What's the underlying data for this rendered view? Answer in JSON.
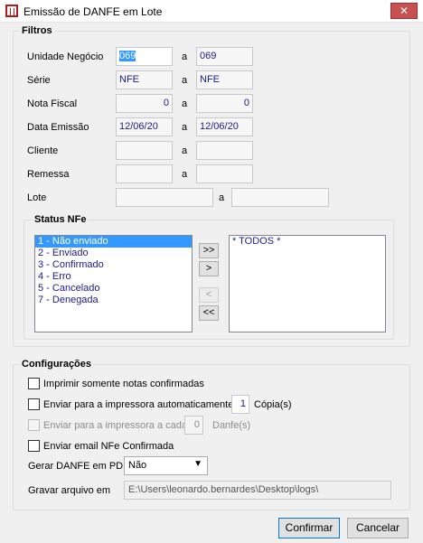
{
  "window": {
    "title": "Emissão de DANFE em Lote",
    "close_glyph": "✕"
  },
  "filtros": {
    "title": "Filtros",
    "range_sep": "a",
    "rows": [
      {
        "label": "Unidade Negócio",
        "from": "069",
        "to": "069"
      },
      {
        "label": "Série",
        "from": "NFE",
        "to": "NFE"
      },
      {
        "label": "Nota Fiscal",
        "from": "0",
        "to": "0"
      },
      {
        "label": "Data Emissão",
        "from": "12/06/20",
        "to": "12/06/20"
      },
      {
        "label": "Cliente",
        "from": "",
        "to": ""
      },
      {
        "label": "Remessa",
        "from": "",
        "to": ""
      },
      {
        "label": "Lote",
        "from": "",
        "to": ""
      }
    ]
  },
  "status_nfe": {
    "title": "Status NFe",
    "available": [
      "1 - Não enviado",
      "2 - Enviado",
      "3 - Confirmado",
      "4 - Erro",
      "5 - Cancelado",
      "7 - Denegada"
    ],
    "selected": [
      "* TODOS *"
    ],
    "buttons": {
      "add_all": ">>",
      "add": ">",
      "remove": "<",
      "remove_all": "<<"
    }
  },
  "config": {
    "title": "Configurações",
    "print_confirmed": "Imprimir somente notas confirmadas",
    "send_auto": "Enviar para a impressora automaticamente",
    "send_auto_copies": "1",
    "send_auto_suffix": "Cópia(s)",
    "send_each": "Enviar para a impressora a cada",
    "send_each_value": "0",
    "send_each_suffix": "Danfe(s)",
    "email": "Enviar email NFe Confirmada",
    "pdf_label": "Gerar DANFE em PDF",
    "pdf_value": "Não",
    "save_label": "Gravar arquivo em",
    "save_path": "E:\\Users\\leonardo.bernardes\\Desktop\\logs\\"
  },
  "buttons": {
    "confirm": "Confirmar",
    "cancel": "Cancelar"
  }
}
